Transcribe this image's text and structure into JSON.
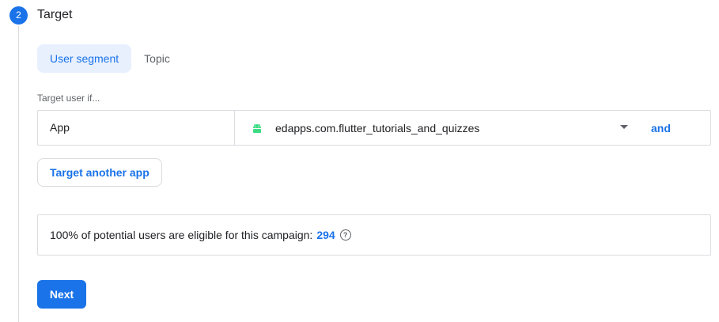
{
  "step": {
    "number": "2",
    "title": "Target"
  },
  "tabs": [
    {
      "label": "User segment",
      "active": true
    },
    {
      "label": "Topic",
      "active": false
    }
  ],
  "targeting": {
    "label": "Target user if...",
    "condition": {
      "field": "App",
      "value": "edapps.com.flutter_tutorials_and_quizzes",
      "value_icon": "android-icon",
      "connector": "and"
    },
    "add_button": "Target another app"
  },
  "eligibility": {
    "text": "100% of potential users are eligible for this campaign:",
    "count": "294",
    "help_icon": "help-circle-icon"
  },
  "actions": {
    "next_label": "Next"
  },
  "colors": {
    "accent": "#1a73e8",
    "android": "#3ddc84",
    "border": "#dadce0"
  }
}
